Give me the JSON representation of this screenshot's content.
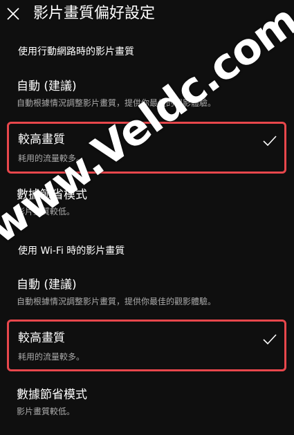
{
  "header": {
    "title": "影片畫質偏好設定",
    "close_icon": "close-icon"
  },
  "sections": [
    {
      "heading": "使用行動網路時的影片畫質",
      "options": [
        {
          "label": "自動 (建議)",
          "description": "自動根據情況調整影片畫質，提供你最佳的觀影體驗。",
          "selected": false
        },
        {
          "label": "較高畫質",
          "description": "耗用的流量較多。",
          "selected": true
        },
        {
          "label": "數據節省模式",
          "description": "影片畫質較低。",
          "selected": false
        }
      ]
    },
    {
      "heading": "使用 Wi-Fi 時的影片畫質",
      "options": [
        {
          "label": "自動 (建議)",
          "description": "自動根據情況調整影片畫質，提供你最佳的觀影體驗。",
          "selected": false
        },
        {
          "label": "較高畫質",
          "description": "耗用的流量較多。",
          "selected": true
        },
        {
          "label": "數據節省模式",
          "description": "影片畫質較低。",
          "selected": false
        }
      ]
    }
  ],
  "watermark": "www.Veldc.com",
  "colors": {
    "background": "#0f0f0f",
    "text_primary": "#ffffff",
    "text_secondary": "#aaaaaa",
    "highlight_border": "#e8474c"
  }
}
